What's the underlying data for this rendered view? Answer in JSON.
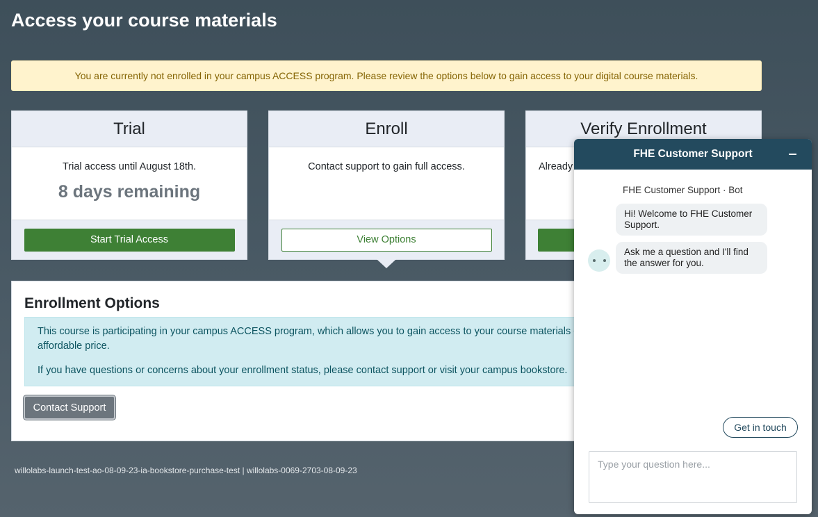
{
  "page": {
    "title": "Access your course materials",
    "alert": "You are currently not enrolled in your campus ACCESS program. Please review the options below to gain access to your digital course materials."
  },
  "cards": {
    "trial": {
      "title": "Trial",
      "text": "Trial access until August 18th.",
      "remaining": "8 days remaining",
      "button": "Start Trial Access"
    },
    "enroll": {
      "title": "Enroll",
      "text": "Contact support to gain full access.",
      "button": "View Options"
    },
    "verify": {
      "title": "Verify Enrollment",
      "text": "Already"
    }
  },
  "enrollment_options": {
    "title": "Enrollment Options",
    "info_line1": "This course is participating in your campus ACCESS program, which allows you to gain access to your course materials c",
    "info_line1b": "affordable price.",
    "info_line2": "If you have questions or concerns about your enrollment status, please contact support or visit your campus bookstore.",
    "contact_button": "Contact Support"
  },
  "footer": {
    "text": "willolabs-launch-test-ao-08-09-23-ia-bookstore-purchase-test | willolabs-0069-2703-08-09-23"
  },
  "chat": {
    "header": "FHE Customer Support",
    "sender": "FHE Customer Support  ·  Bot",
    "messages": [
      "Hi! Welcome to FHE Customer Support.",
      "Ask me a question and I'll find the answer for you."
    ],
    "get_in_touch": "Get in touch",
    "input_placeholder": "Type your question here..."
  },
  "colors": {
    "brand_green": "#3e8035",
    "chat_header": "#234a5e",
    "alert_bg": "#fff3cd",
    "info_bg": "#d1ecf1"
  }
}
